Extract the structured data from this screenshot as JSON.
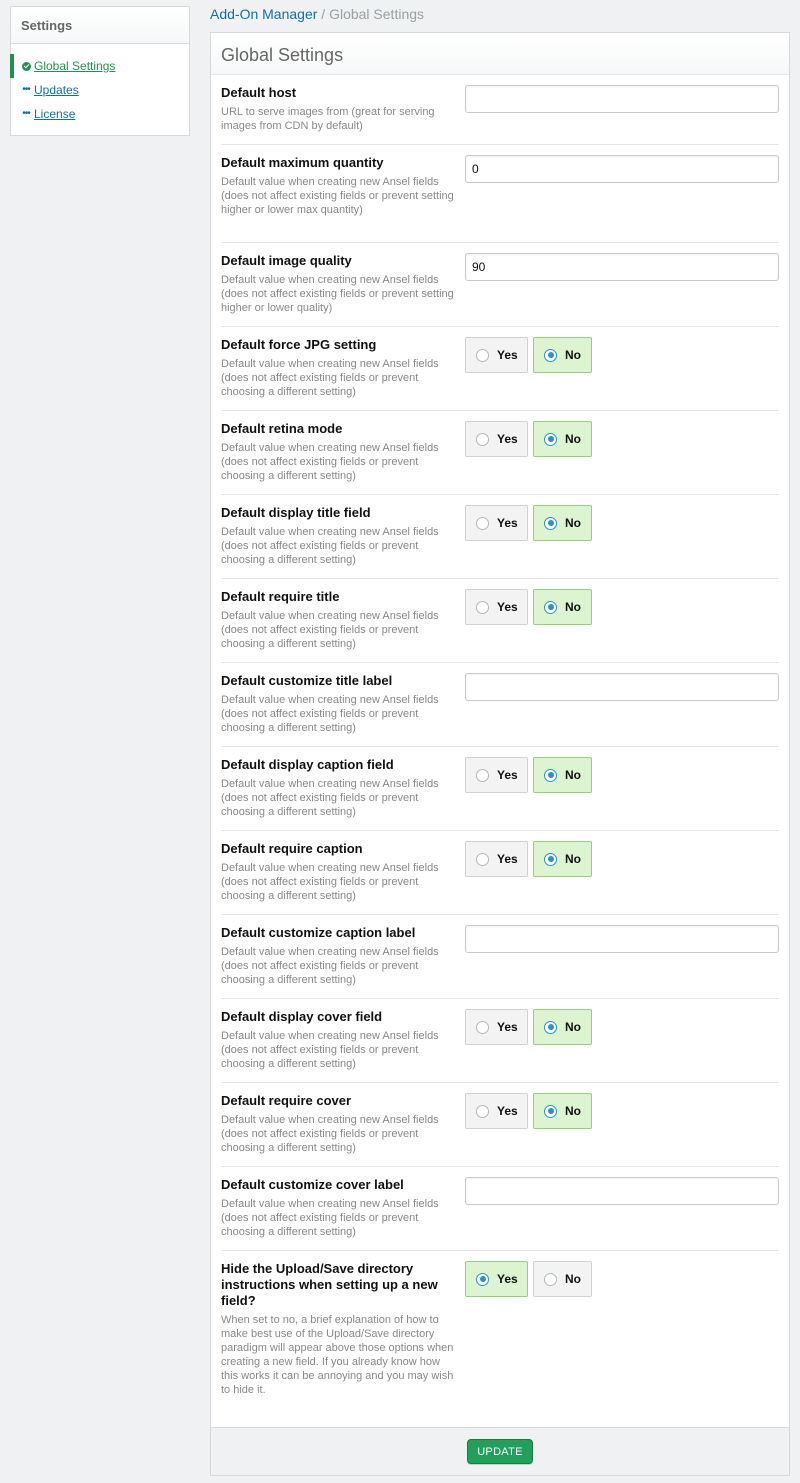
{
  "sidebar": {
    "title": "Settings",
    "items": [
      {
        "label": "Global Settings",
        "icon": "check-circle-icon",
        "active": true
      },
      {
        "label": "Updates",
        "icon": "dots-icon",
        "active": false
      },
      {
        "label": "License",
        "icon": "dots-icon",
        "active": false
      }
    ]
  },
  "breadcrumb": {
    "parent": "Add-On Manager",
    "separator": "/",
    "current": "Global Settings"
  },
  "panel": {
    "title": "Global Settings",
    "yes_label": "Yes",
    "no_label": "No",
    "update_label": "UPDATE",
    "fields": [
      {
        "title": "Default host",
        "desc": "URL to serve images from (great for serving images from CDN by default)",
        "type": "text",
        "value": ""
      },
      {
        "title": "Default maximum quantity",
        "desc": "Default value when creating new Ansel fields (does not affect existing fields or prevent setting higher or lower max quantity)",
        "type": "text",
        "value": "0"
      },
      {
        "title": "Default image quality",
        "desc": "Default value when creating new Ansel fields (does not affect existing fields or prevent setting higher or lower quality)",
        "type": "text",
        "value": "90"
      },
      {
        "title": "Default force JPG setting",
        "desc": "Default value when creating new Ansel fields (does not affect existing fields or prevent choosing a different setting)",
        "type": "toggle",
        "value": "No"
      },
      {
        "title": "Default retina mode",
        "desc": "Default value when creating new Ansel fields (does not affect existing fields or prevent choosing a different setting)",
        "type": "toggle",
        "value": "No"
      },
      {
        "title": "Default display title field",
        "desc": "Default value when creating new Ansel fields (does not affect existing fields or prevent choosing a different setting)",
        "type": "toggle",
        "value": "No"
      },
      {
        "title": "Default require title",
        "desc": "Default value when creating new Ansel fields (does not affect existing fields or prevent choosing a different setting)",
        "type": "toggle",
        "value": "No"
      },
      {
        "title": "Default customize title label",
        "desc": "Default value when creating new Ansel fields (does not affect existing fields or prevent choosing a different setting)",
        "type": "text",
        "value": ""
      },
      {
        "title": "Default display caption field",
        "desc": "Default value when creating new Ansel fields (does not affect existing fields or prevent choosing a different setting)",
        "type": "toggle",
        "value": "No"
      },
      {
        "title": "Default require caption",
        "desc": "Default value when creating new Ansel fields (does not affect existing fields or prevent choosing a different setting)",
        "type": "toggle",
        "value": "No"
      },
      {
        "title": "Default customize caption label",
        "desc": "Default value when creating new Ansel fields (does not affect existing fields or prevent choosing a different setting)",
        "type": "text",
        "value": ""
      },
      {
        "title": "Default display cover field",
        "desc": "Default value when creating new Ansel fields (does not affect existing fields or prevent choosing a different setting)",
        "type": "toggle",
        "value": "No"
      },
      {
        "title": "Default require cover",
        "desc": "Default value when creating new Ansel fields (does not affect existing fields or prevent choosing a different setting)",
        "type": "toggle",
        "value": "No"
      },
      {
        "title": "Default customize cover label",
        "desc": "Default value when creating new Ansel fields (does not affect existing fields or prevent choosing a different setting)",
        "type": "text",
        "value": ""
      },
      {
        "title": "Hide the Upload/Save directory instructions when setting up a new field?",
        "desc": "When set to no, a brief explanation of how to make best use of the Upload/Save directory paradigm will appear above those options when creating a new field. If you already know how this works it can be annoying and you may wish to hide it.",
        "type": "toggle",
        "value": "Yes"
      }
    ]
  },
  "colors": {
    "accent_green": "#21914f",
    "link_blue": "#0f6fa8",
    "radio_blue": "#2a8fd6",
    "selected_bg": "#dcf5d0"
  }
}
